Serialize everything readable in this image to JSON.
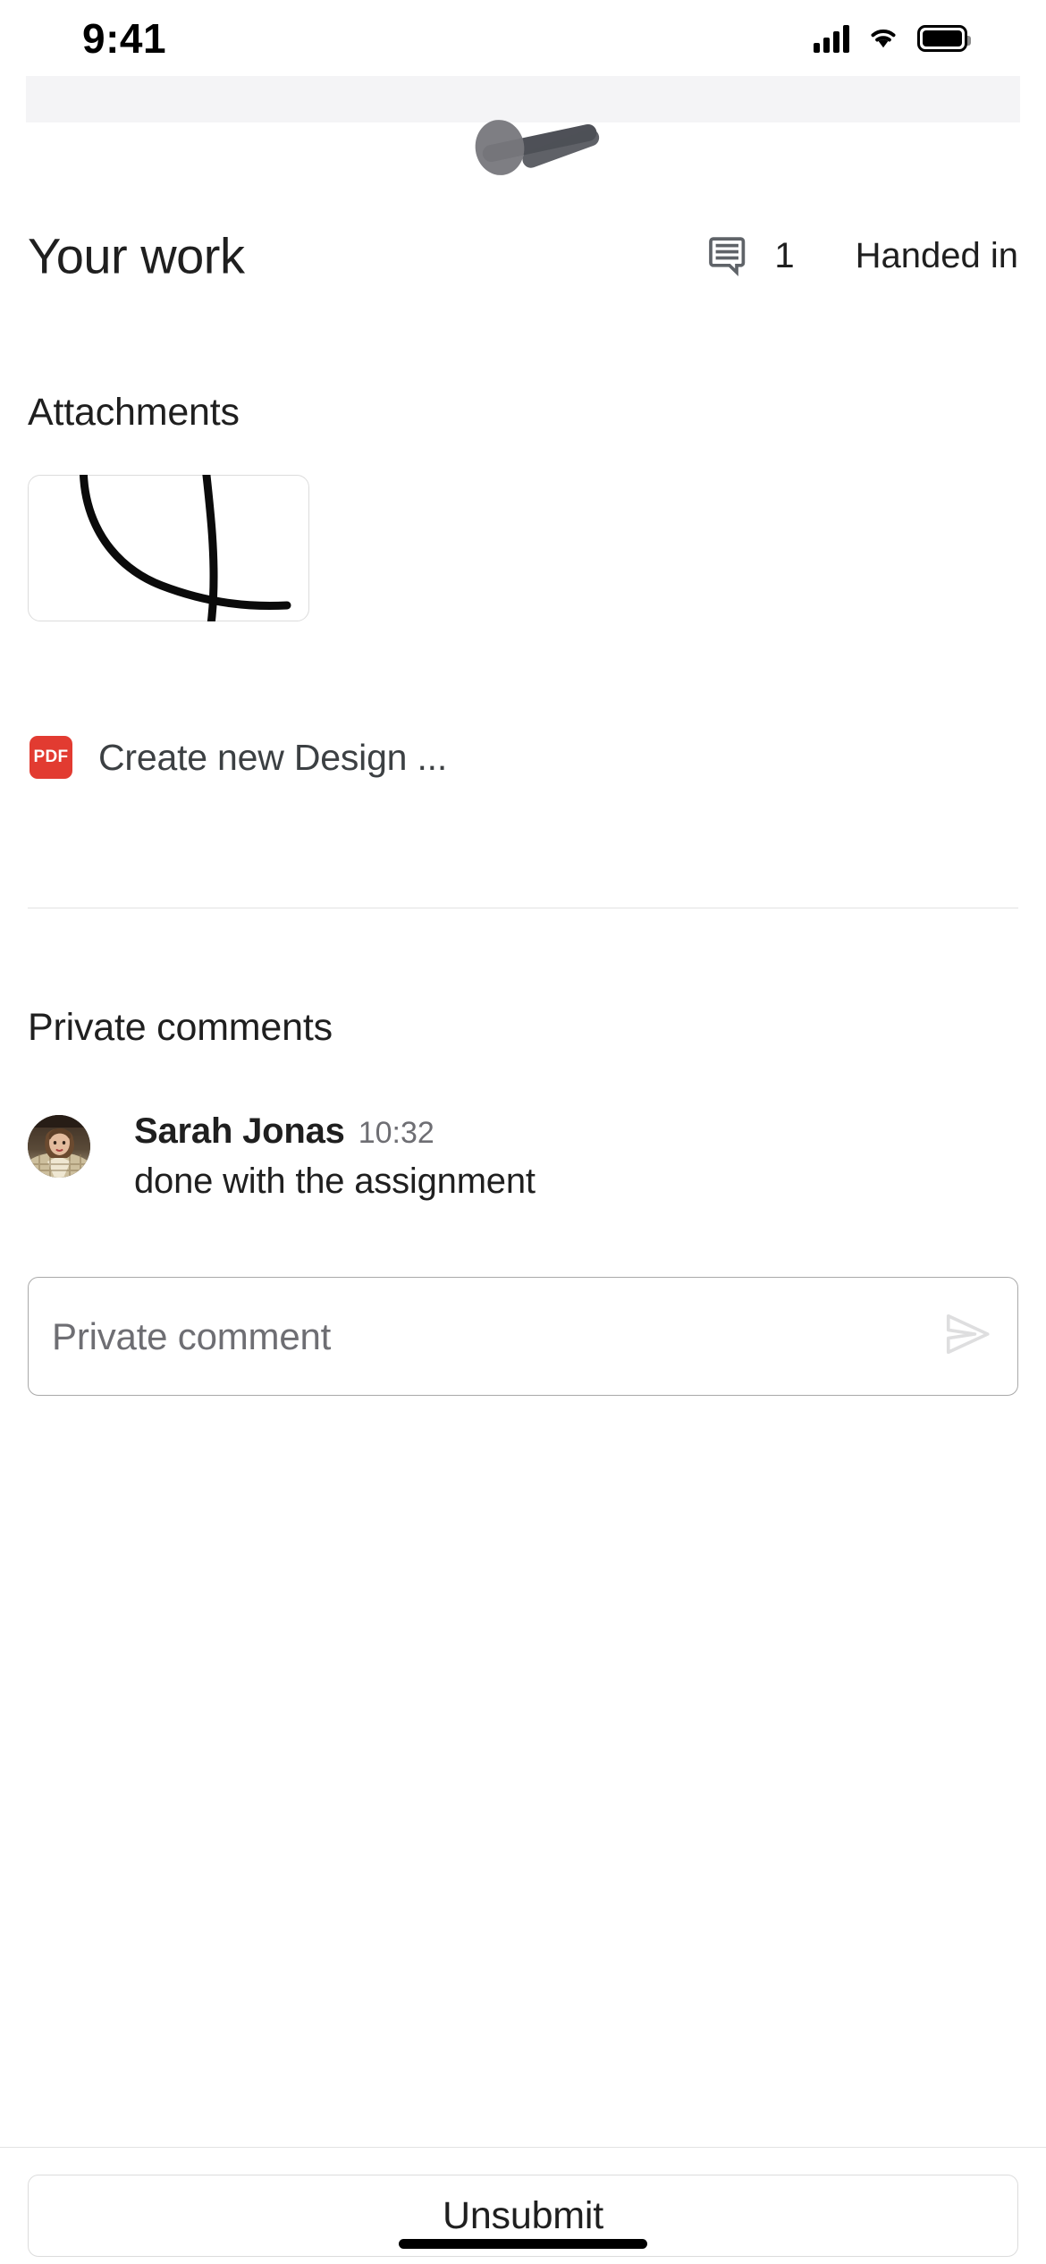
{
  "status_bar": {
    "time": "9:41",
    "icons": [
      "cellular-signal-icon",
      "wifi-icon",
      "battery-icon"
    ]
  },
  "sheet": {
    "grabber": "drag-handle",
    "cursor": "pointer-cursor-indicator"
  },
  "header": {
    "title": "Your work",
    "comment_icon": "comment-bubble-icon",
    "comment_count": "1",
    "status": "Handed in"
  },
  "attachments": {
    "heading": "Attachments",
    "items": [
      {
        "thumbnail": "handwritten-sketch-thumbnail",
        "file_type_badge": "PDF",
        "badge_color": "#e23b31",
        "name": "Create new Design ..."
      }
    ]
  },
  "private_comments": {
    "heading": "Private comments",
    "comments": [
      {
        "avatar": "user-avatar-photo",
        "author": "Sarah Jonas",
        "time": "10:32",
        "text": "done with the assignment"
      }
    ],
    "input": {
      "placeholder": "Private comment",
      "value": "",
      "send_icon": "send-paper-plane-icon"
    }
  },
  "bottom_bar": {
    "primary_action": "Unsubmit",
    "home_indicator": "home-indicator"
  },
  "colors": {
    "text_primary": "#1f1f1f",
    "text_secondary": "#6e6e73",
    "border": "#dcdcdc",
    "sheet_band": "#f4f4f6",
    "pdf_red": "#e23b31",
    "background": "#ffffff"
  }
}
